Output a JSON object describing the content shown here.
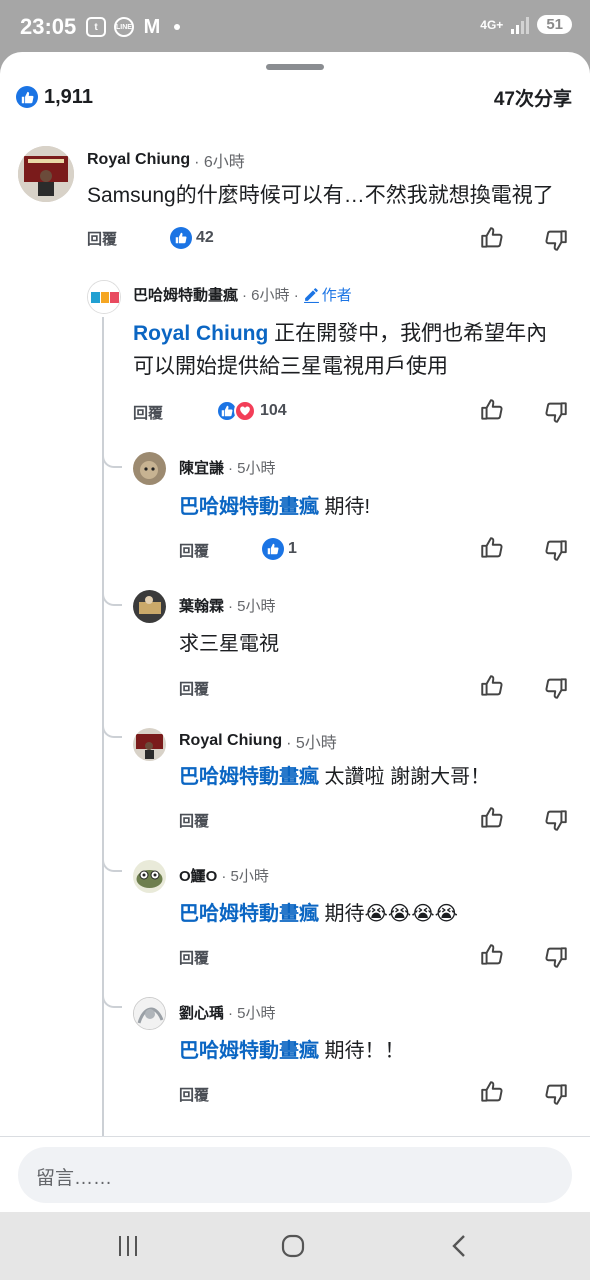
{
  "status_bar": {
    "time": "23:05",
    "notification_icons": [
      "t",
      "LINE",
      "M"
    ],
    "network": "4G+",
    "battery": "51"
  },
  "summary": {
    "likes": "1,911",
    "shares": "47次分享"
  },
  "composer": {
    "placeholder": "留言……"
  },
  "reply_label": "回覆",
  "author_label": "作者",
  "comments": [
    {
      "name": "Royal Chiung",
      "time": "· 6小時",
      "text": "Samsung的什麼時候可以有…不然我就想換電視了",
      "reactions": "42"
    },
    {
      "name": "巴哈姆特動畫瘋",
      "time": "· 6小時 ·",
      "mention": "Royal Chiung",
      "text_line1": " 正在開發中，我們也希望年內",
      "text_line2": "可以開始提供給三星電視用戶使用",
      "reactions": "104"
    },
    {
      "name": "陳宜謙",
      "time": "· 5小時",
      "mention": "巴哈姆特動畫瘋",
      "text": " 期待!",
      "reactions": "1"
    },
    {
      "name": "葉翰霖",
      "time": "· 5小時",
      "text": "求三星電視"
    },
    {
      "name": "Royal Chiung",
      "time": "· 5小時",
      "mention": "巴哈姆特動畫瘋",
      "text": " 太讚啦 謝謝大哥！"
    },
    {
      "name": "O鱷O",
      "time": "· 5小時",
      "mention": "巴哈姆特動畫瘋",
      "text": " 期待😭😭😭😭"
    },
    {
      "name": "劉心瑀",
      "time": "· 5小時",
      "mention": "巴哈姆特動畫瘋",
      "text": " 期待！！"
    }
  ],
  "colors": {
    "accent": "#1b74e4",
    "mention": "#0b66c3",
    "love": "#f33e58"
  }
}
